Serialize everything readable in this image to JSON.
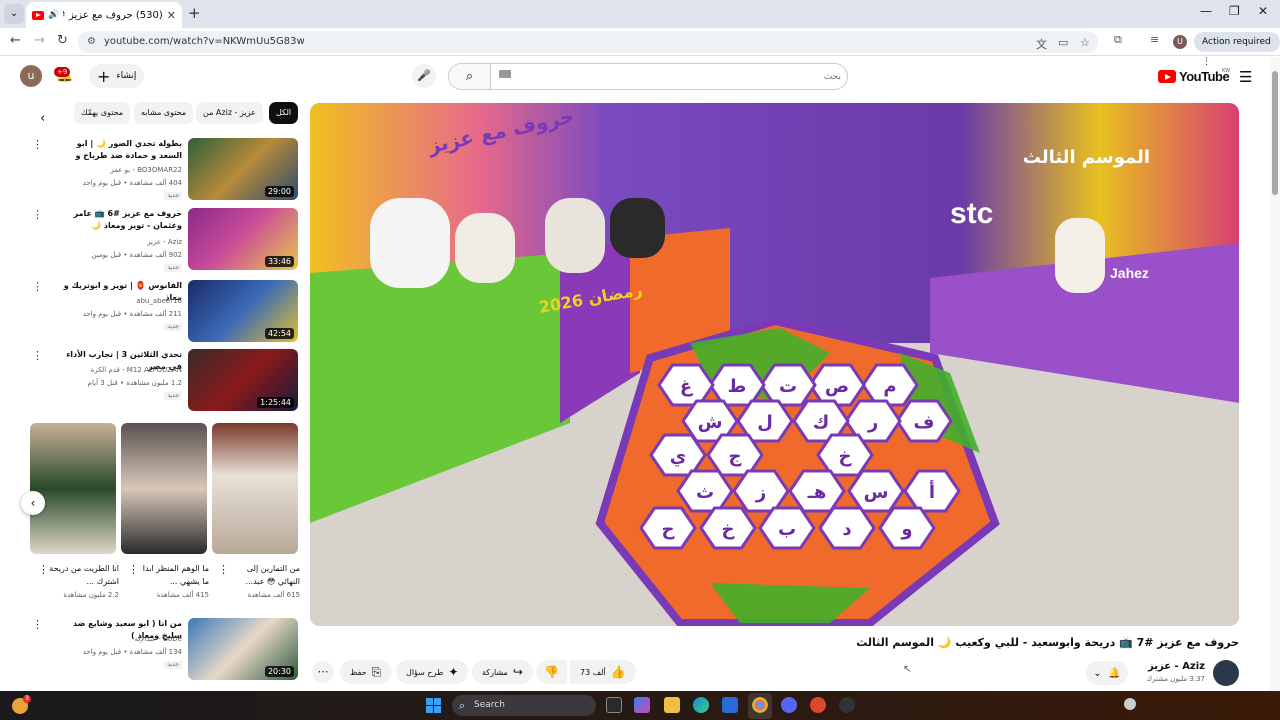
{
  "browser": {
    "tab_title": "(530) حروف مع عزيز #7 📺",
    "url": "youtube.com/watch?v=NKWmUu5G83w",
    "action_required": "Action required",
    "profile_letter": "U"
  },
  "header": {
    "create_label": "إنشاء",
    "notifications": "+9",
    "search_placeholder": "بحث",
    "logo_text": "YouTube",
    "country": "KW",
    "avatar_letter": "u"
  },
  "chips": [
    "الكل",
    "من Aziz - عزيز",
    "محتوى مشابه",
    "محتوى يهمّك"
  ],
  "related": [
    {
      "title": "بطولة تحدي الصور 🌙 | ابو السعد و حمادة ضد طرباخ و بودي",
      "channel": "BO3OMAR22 - بو عمر",
      "stats": "404 ألف مشاهدة • قبل يوم واحد",
      "badge": "جديد",
      "duration": "29:00"
    },
    {
      "title": "حروف مع عزيز #6 📺 عامر وعثمان - تويز ومعاذ 🌙 الموسم الثالث",
      "channel": "Aziz - عزيز",
      "stats": "902 ألف مشاهدة • قبل يومين",
      "badge": "جديد",
      "duration": "33:46"
    },
    {
      "title": "الفانوس 🏮 | تويز و ابوتريك و معاذ",
      "channel": "abu_abeer16",
      "stats": "211 ألف مشاهدة • قبل يوم واحد",
      "badge": "جديد",
      "duration": "42:54"
    },
    {
      "title": "تحدي الثلاثين 3 | تجارب الأداء في مصر",
      "channel": "M12 ALFOUZAN - قدم الكرة",
      "stats": "1.2 مليون مشاهدة • قبل 3 أيام",
      "badge": "جديد",
      "duration": "1:25:44"
    },
    {
      "title": "من انا ( ابو سعيد وشايع ضد سليخ ومعاذ )",
      "channel": "BoDe - عبدالإله",
      "stats": "134 ألف مشاهدة • قبل يوم واحد",
      "badge": "جديد",
      "duration": "20:30"
    }
  ],
  "shorts": [
    {
      "title": "من التمارين إلى النهائي 😳 عبد...",
      "views": "615 ألف مشاهدة"
    },
    {
      "title": "ما الوهم المنظر ابدا ما يشهي ...",
      "views": "415 ألف مشاهدة"
    },
    {
      "title": "انا الطريت من دريحة اشترك ...",
      "views": "2.2 مليون مشاهدة"
    }
  ],
  "video": {
    "title": "حروف مع عزيز #7 📺 دريحة وابوسعيد - للبي وكعيب 🌙 الموسم الثالث",
    "channel": "Aziz - عزيز",
    "subscribers": "3.37 مليون مشترك",
    "likes": "73 ألف",
    "share": "مشاركة",
    "ask": "طرح سؤال",
    "save": "حفظ",
    "scene_letters": [
      "م",
      "ص",
      "ت",
      "ط",
      "غ",
      "ف",
      "ر",
      "ك",
      "ل",
      "ش",
      "خ",
      "ج",
      "ي",
      "أ",
      "س",
      "هـ",
      "ز",
      "ث",
      "و",
      "د",
      "ب",
      "خ",
      "ح"
    ],
    "scene_texts": {
      "logo": "حروف مع عزيز",
      "season": "الموسم الثالث",
      "ramadan": "رمضان 2026",
      "sponsor": "stc",
      "sponsor2": "Jahez"
    }
  },
  "taskbar": {
    "search": "Search",
    "weather_badge": "3"
  },
  "colors": {
    "accent": "#ff0000",
    "hex_green": "#43b02a",
    "hex_orange": "#ef6a2b",
    "set_purple": "#6b4aa8"
  }
}
